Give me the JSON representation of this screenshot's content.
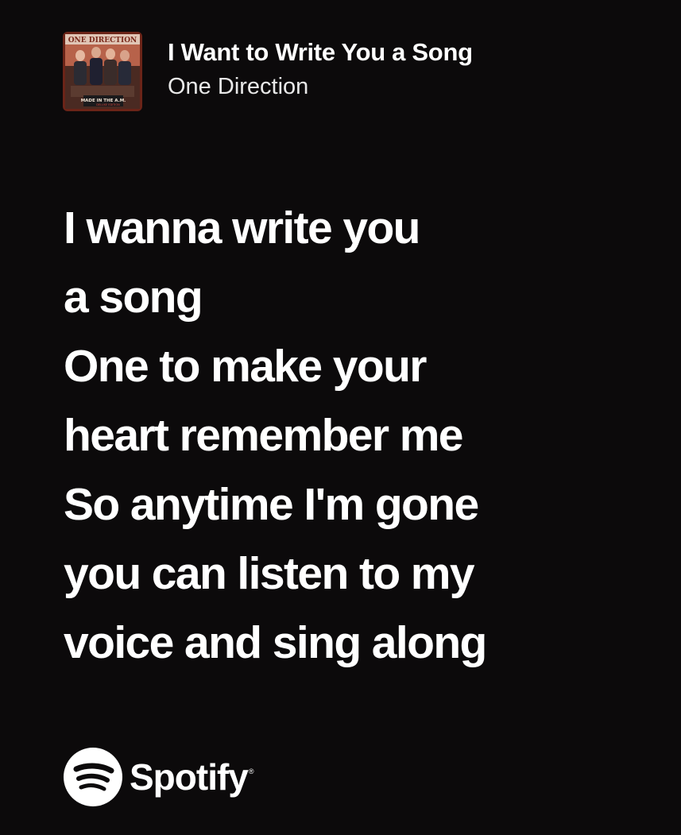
{
  "track": {
    "title": "I Want to Write You a Song",
    "artist": "One Direction",
    "album_cover": {
      "band_logo_text": "ONE DIRECTION",
      "album_text": "MADE IN THE A.M.",
      "edition_text": "DELUXE EDITION",
      "accent_color": "#c43a2a"
    }
  },
  "lyrics": [
    "I wanna write you",
    "a song",
    "One to make your",
    "heart remember me",
    "So anytime I'm gone",
    "you can listen to my",
    "voice and sing along"
  ],
  "branding": {
    "name": "Spotify",
    "trademark": "®",
    "icon": "spotify-logo-icon"
  },
  "colors": {
    "background": "#0c0a0b",
    "text": "#ffffff"
  }
}
